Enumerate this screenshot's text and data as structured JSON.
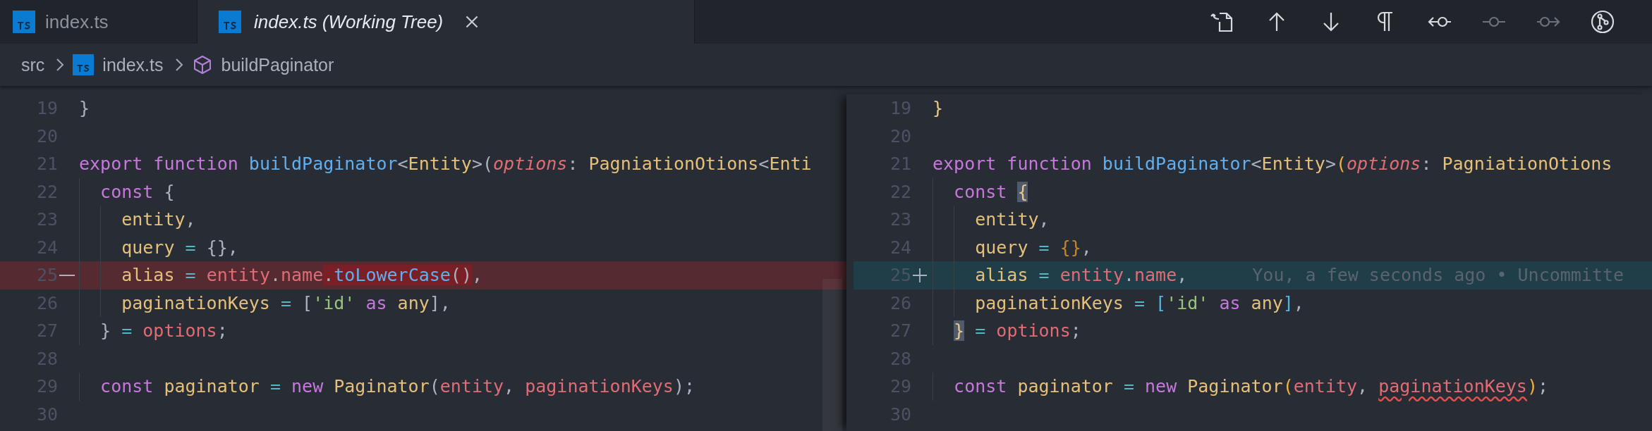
{
  "tabs": [
    {
      "label": "index.ts",
      "selected": false,
      "preview": false
    },
    {
      "label": "index.ts (Working Tree)",
      "selected": true,
      "preview": true
    }
  ],
  "toolbar": [
    {
      "kind": "open-file",
      "disabled": false
    },
    {
      "kind": "up",
      "disabled": false
    },
    {
      "kind": "down",
      "disabled": false
    },
    {
      "kind": "pilcrow",
      "disabled": false
    },
    {
      "kind": "prev",
      "disabled": false
    },
    {
      "kind": "commit",
      "disabled": true
    },
    {
      "kind": "next",
      "disabled": true
    },
    {
      "kind": "compare",
      "disabled": false
    }
  ],
  "breadcrumb": [
    {
      "label": "src",
      "kind": "folder"
    },
    {
      "label": "index.ts",
      "kind": "file"
    },
    {
      "label": "buildPaginator",
      "kind": "symbol"
    }
  ],
  "panes": [
    {
      "lines": [
        {
          "number": "19",
          "kind": "context",
          "tokens": [
            {
              "text": "}",
              "kind": "punct"
            }
          ]
        },
        {
          "number": "20",
          "kind": "context"
        },
        {
          "number": "21",
          "kind": "context",
          "tokens": [
            {
              "text": "export function ",
              "kind": "kw"
            },
            {
              "text": "buildPaginator",
              "kind": "fn"
            },
            {
              "text": "<",
              "kind": "punct"
            },
            {
              "text": "Entity",
              "kind": "type"
            },
            {
              "text": ">(",
              "kind": "punct"
            },
            {
              "text": "options",
              "kind": "param"
            },
            {
              "text": ": ",
              "kind": "punct"
            },
            {
              "text": "PagniationOtions",
              "kind": "type"
            },
            {
              "text": "<",
              "kind": "punct"
            },
            {
              "text": "Enti",
              "kind": "type"
            }
          ]
        },
        {
          "number": "22",
          "kind": "context",
          "tokens": [
            {
              "text": "  const",
              "kind": "kw"
            },
            {
              "text": " {",
              "kind": "punct"
            }
          ]
        },
        {
          "number": "23",
          "kind": "context",
          "tokens": [
            {
              "text": "    entity",
              "kind": "var"
            },
            {
              "text": ",",
              "kind": "punct"
            }
          ]
        },
        {
          "number": "24",
          "kind": "context",
          "tokens": [
            {
              "text": "    query",
              "kind": "var"
            },
            {
              "text": " = ",
              "kind": "op"
            },
            {
              "text": "{},",
              "kind": "punct"
            }
          ]
        },
        {
          "number": "25",
          "kind": "removed",
          "tokens": [
            {
              "text": "    alias",
              "kind": "var"
            },
            {
              "text": " = ",
              "kind": "op"
            },
            {
              "text": "entity",
              "kind": "prop"
            },
            {
              "text": ".",
              "kind": "punct"
            },
            {
              "text": "name",
              "kind": "prop"
            },
            {
              "text": ".",
              "kind": "punct",
              "changed": true
            },
            {
              "text": "toLowerCase",
              "kind": "fn",
              "changed": true
            },
            {
              "text": "()",
              "kind": "punct",
              "changed": true
            },
            {
              "text": ",",
              "kind": "punct"
            }
          ]
        },
        {
          "number": "26",
          "kind": "context",
          "tokens": [
            {
              "text": "    paginationKeys",
              "kind": "var"
            },
            {
              "text": " = ",
              "kind": "op"
            },
            {
              "text": "[",
              "kind": "punct"
            },
            {
              "text": "'id'",
              "kind": "str"
            },
            {
              "text": " as ",
              "kind": "kw"
            },
            {
              "text": "any",
              "kind": "type"
            },
            {
              "text": "],",
              "kind": "punct"
            }
          ]
        },
        {
          "number": "27",
          "kind": "context",
          "tokens": [
            {
              "text": "  }",
              "kind": "punct"
            },
            {
              "text": " = ",
              "kind": "op"
            },
            {
              "text": "options",
              "kind": "prop"
            },
            {
              "text": ";",
              "kind": "punct"
            }
          ]
        },
        {
          "number": "28",
          "kind": "context"
        },
        {
          "number": "29",
          "kind": "context",
          "tokens": [
            {
              "text": "  const",
              "kind": "kw"
            },
            {
              "text": " paginator",
              "kind": "var"
            },
            {
              "text": " = ",
              "kind": "op"
            },
            {
              "text": "new",
              "kind": "kw"
            },
            {
              "text": " Paginator",
              "kind": "type"
            },
            {
              "text": "(",
              "kind": "punct"
            },
            {
              "text": "entity",
              "kind": "prop"
            },
            {
              "text": ", ",
              "kind": "punct"
            },
            {
              "text": "paginationKeys",
              "kind": "prop"
            },
            {
              "text": ");",
              "kind": "punct"
            }
          ]
        },
        {
          "number": "30",
          "kind": "context"
        }
      ]
    },
    {
      "lines": [
        {
          "number": "19",
          "kind": "context",
          "tokens": [
            {
              "text": "}",
              "kind": "bracket-pale"
            }
          ]
        },
        {
          "number": "20",
          "kind": "context"
        },
        {
          "number": "21",
          "kind": "context",
          "tokens": [
            {
              "text": "export function ",
              "kind": "kw"
            },
            {
              "text": "buildPaginator",
              "kind": "fn"
            },
            {
              "text": "<",
              "kind": "punct"
            },
            {
              "text": "Entity",
              "kind": "type"
            },
            {
              "text": ">",
              "kind": "punct"
            },
            {
              "text": "(",
              "kind": "bracket-gold"
            },
            {
              "text": "options",
              "kind": "param"
            },
            {
              "text": ": ",
              "kind": "punct"
            },
            {
              "text": "PagniationOtions",
              "kind": "type"
            }
          ]
        },
        {
          "number": "22",
          "kind": "context",
          "tokens": [
            {
              "text": "  const ",
              "kind": "kw"
            },
            {
              "text": "{",
              "kind": "bracket-pale",
              "matched": true
            }
          ]
        },
        {
          "number": "23",
          "kind": "context",
          "tokens": [
            {
              "text": "    entity",
              "kind": "var"
            },
            {
              "text": ",",
              "kind": "punct"
            }
          ]
        },
        {
          "number": "24",
          "kind": "context",
          "tokens": [
            {
              "text": "    query",
              "kind": "var"
            },
            {
              "text": " = ",
              "kind": "op"
            },
            {
              "text": "{}",
              "kind": "bracket-amber"
            },
            {
              "text": ",",
              "kind": "punct"
            }
          ]
        },
        {
          "number": "25",
          "kind": "added",
          "annotation": "You, a few seconds ago • Uncommitte",
          "tokens": [
            {
              "text": "    alias",
              "kind": "var"
            },
            {
              "text": " = ",
              "kind": "op"
            },
            {
              "text": "entity",
              "kind": "prop"
            },
            {
              "text": ".",
              "kind": "punct"
            },
            {
              "text": "name",
              "kind": "prop"
            },
            {
              "text": ",",
              "kind": "punct"
            }
          ]
        },
        {
          "number": "26",
          "kind": "context",
          "tokens": [
            {
              "text": "    paginationKeys",
              "kind": "var"
            },
            {
              "text": " = ",
              "kind": "op"
            },
            {
              "text": "[",
              "kind": "bracket-blue"
            },
            {
              "text": "'id'",
              "kind": "str"
            },
            {
              "text": " as ",
              "kind": "kw"
            },
            {
              "text": "any",
              "kind": "type"
            },
            {
              "text": "]",
              "kind": "bracket-blue"
            },
            {
              "text": ",",
              "kind": "punct"
            }
          ]
        },
        {
          "number": "27",
          "kind": "context",
          "tokens": [
            {
              "text": "  }",
              "kind": "bracket-pale",
              "matched": true
            },
            {
              "text": " = ",
              "kind": "op"
            },
            {
              "text": "options",
              "kind": "prop"
            },
            {
              "text": ";",
              "kind": "punct"
            }
          ]
        },
        {
          "number": "28",
          "kind": "context"
        },
        {
          "number": "29",
          "kind": "context",
          "tokens": [
            {
              "text": "  const",
              "kind": "kw"
            },
            {
              "text": " paginator",
              "kind": "var"
            },
            {
              "text": " = ",
              "kind": "op"
            },
            {
              "text": "new",
              "kind": "kw"
            },
            {
              "text": " Paginator",
              "kind": "type"
            },
            {
              "text": "(",
              "kind": "bracket-gold"
            },
            {
              "text": "entity",
              "kind": "prop"
            },
            {
              "text": ", ",
              "kind": "punct"
            },
            {
              "text": "paginationKeys",
              "kind": "prop",
              "error": true
            },
            {
              "text": ")",
              "kind": "bracket-gold"
            },
            {
              "text": ";",
              "kind": "punct"
            }
          ]
        },
        {
          "number": "30",
          "kind": "context"
        }
      ]
    }
  ]
}
